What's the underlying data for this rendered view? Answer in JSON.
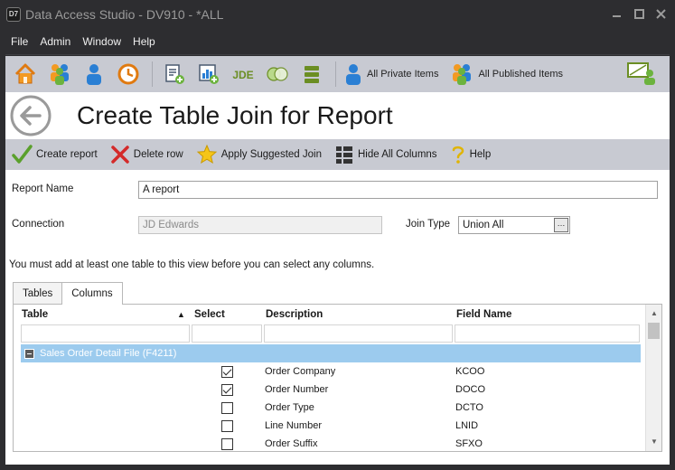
{
  "window": {
    "logo": "D7",
    "title": "Data Access Studio - DV910 - *ALL"
  },
  "menu": [
    "File",
    "Admin",
    "Window",
    "Help"
  ],
  "toolbar": {
    "icons": [
      "home-icon",
      "users-group-icon",
      "user-icon",
      "clock-icon",
      "report-add-icon",
      "chart-add-icon",
      "jde-icon",
      "toggle-icon",
      "stack-icon"
    ],
    "jde_label": "JDE",
    "private_items": "All Private Items",
    "published_items": "All Published Items"
  },
  "page": {
    "title": "Create Table Join for Report"
  },
  "actions": {
    "create_report": "Create report",
    "delete_row": "Delete row",
    "apply_join": "Apply Suggested Join",
    "hide_columns": "Hide All Columns",
    "help": "Help"
  },
  "form": {
    "report_name_label": "Report Name",
    "report_name_value": "A report",
    "connection_label": "Connection",
    "connection_value": "JD Edwards",
    "join_type_label": "Join Type",
    "join_type_value": "Union All",
    "info": "You must add at least one table to this view before you can select any columns."
  },
  "tabs": [
    {
      "label": "Tables",
      "active": false
    },
    {
      "label": "Columns",
      "active": true
    }
  ],
  "grid": {
    "headers": {
      "table": "Table",
      "select": "Select",
      "description": "Description",
      "field_name": "Field Name"
    },
    "sort_indicator": "▲",
    "group": "Sales Order Detail File (F4211)",
    "rows": [
      {
        "selected": true,
        "description": "Order Company",
        "field": "KCOO"
      },
      {
        "selected": true,
        "description": "Order Number",
        "field": "DOCO"
      },
      {
        "selected": false,
        "description": "Order Type",
        "field": "DCTO"
      },
      {
        "selected": false,
        "description": "Line Number",
        "field": "LNID"
      },
      {
        "selected": false,
        "description": "Order Suffix",
        "field": "SFXO"
      }
    ]
  },
  "colors": {
    "toolbar_bg": "#c8cad2",
    "chrome_bg": "#2d2d30",
    "group_row": "#9ccbee"
  }
}
